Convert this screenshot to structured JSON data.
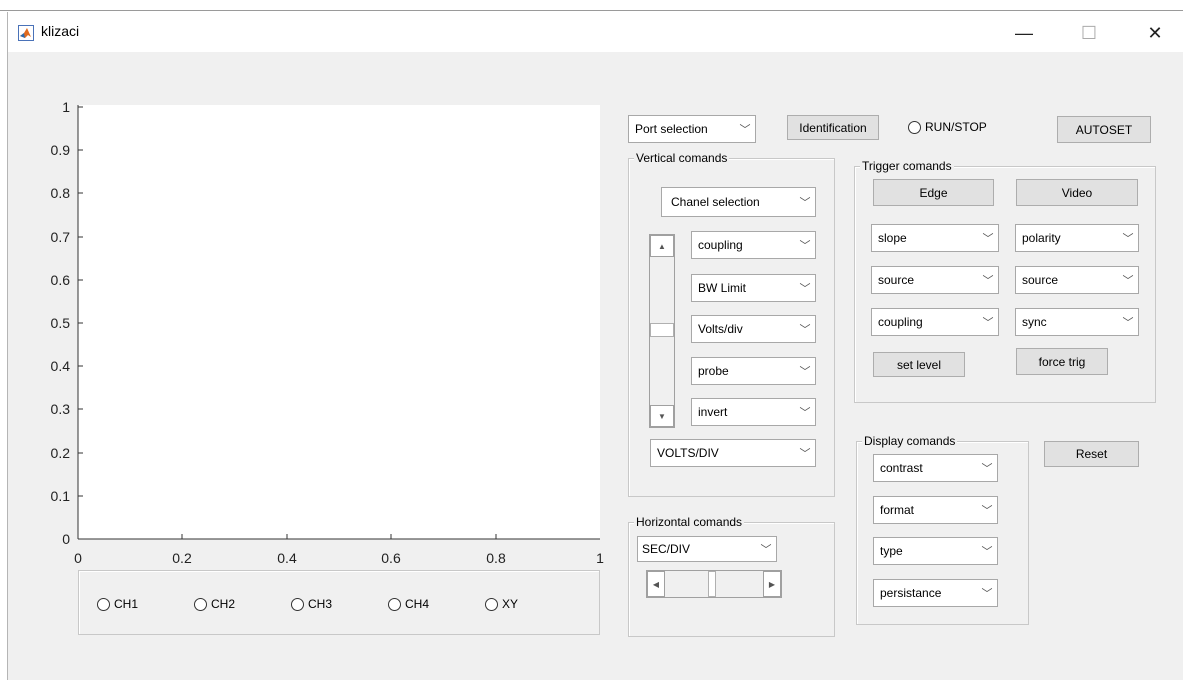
{
  "window": {
    "title": "klizaci",
    "minimize": "—",
    "maximize": "☐",
    "close": "✕"
  },
  "axes": {
    "yticks": [
      "1",
      "0.9",
      "0.8",
      "0.7",
      "0.6",
      "0.5",
      "0.4",
      "0.3",
      "0.2",
      "0.1",
      "0"
    ],
    "xticks": [
      "0",
      "0.2",
      "0.4",
      "0.6",
      "0.8",
      "1"
    ]
  },
  "channels": [
    "CH1",
    "CH2",
    "CH3",
    "CH4",
    "XY"
  ],
  "top": {
    "port_selection": "Port selection",
    "identification": "Identification",
    "run_stop": "RUN/STOP",
    "autoset": "AUTOSET"
  },
  "vertical": {
    "title": "Vertical comands",
    "chanel_selection": "Chanel selection",
    "coupling": "coupling",
    "bw_limit": "BW Limit",
    "volts_div": "Volts/div",
    "probe": "probe",
    "invert": "invert",
    "volts_div_upper": "VOLTS/DIV"
  },
  "trigger": {
    "title": "Trigger comands",
    "edge": "Edge",
    "video": "Video",
    "slope": "slope",
    "polarity": "polarity",
    "source_left": "source",
    "source_right": "source",
    "coupling": "coupling",
    "sync": "sync",
    "set_level": "set level",
    "force_trig": "force trig"
  },
  "display": {
    "title": "Display comands",
    "contrast": "contrast",
    "format": "format",
    "type": "type",
    "persistance": "persistance"
  },
  "reset": "Reset",
  "horizontal": {
    "title": "Horizontal comands",
    "sec_div": "SEC/DIV"
  },
  "colors": {
    "window_bg": "#f0f0f0",
    "button_bg": "#e1e1e1"
  }
}
